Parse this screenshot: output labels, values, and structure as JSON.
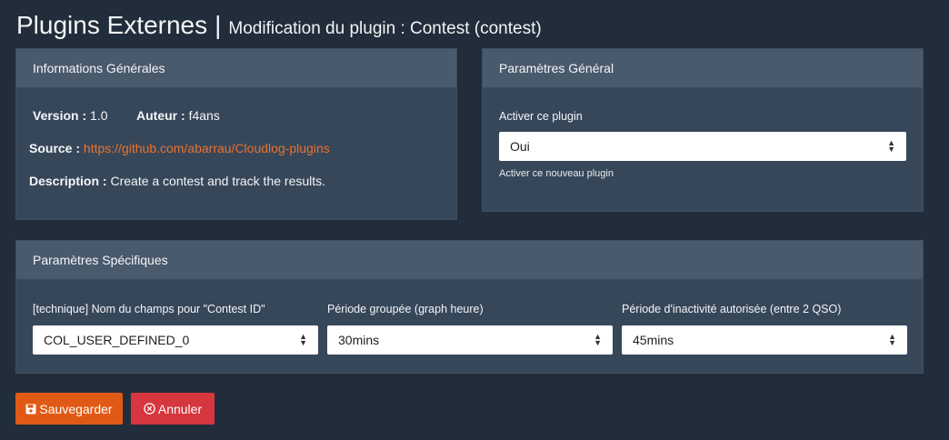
{
  "header": {
    "title": "Plugins Externes",
    "separator": "|",
    "subtitle": "Modification du plugin : Contest (contest)"
  },
  "info_card": {
    "title": "Informations Générales",
    "version_label": "Version :",
    "version_value": "1.0",
    "author_label": "Auteur :",
    "author_value": "f4ans",
    "source_label": "Source :",
    "source_url": "https://github.com/abarrau/Cloudlog-plugins",
    "description_label": "Description :",
    "description_value": "Create a contest and track the results."
  },
  "general_card": {
    "title": "Paramètres Général",
    "enable_label": "Activer ce plugin",
    "enable_value": "Oui",
    "enable_help": "Activer ce nouveau plugin"
  },
  "specific_card": {
    "title": "Paramètres Spécifiques",
    "fields": [
      {
        "label": "[technique] Nom du champs pour \"Contest ID\"",
        "value": "COL_USER_DEFINED_0"
      },
      {
        "label": "Période groupée (graph heure)",
        "value": "30mins"
      },
      {
        "label": "Période d'inactivité autorisée (entre 2 QSO)",
        "value": "45mins"
      }
    ]
  },
  "actions": {
    "save_label": "Sauvegarder",
    "cancel_label": "Annuler"
  },
  "colors": {
    "background": "#222d3b",
    "card": "#37475a",
    "card_header": "#4a5a6d",
    "link": "#e9722e",
    "save": "#e05a15",
    "cancel": "#d6363d"
  },
  "icons": {
    "save": "floppy-disk-icon",
    "cancel": "circle-x-icon",
    "select": "select-caret-icon"
  }
}
